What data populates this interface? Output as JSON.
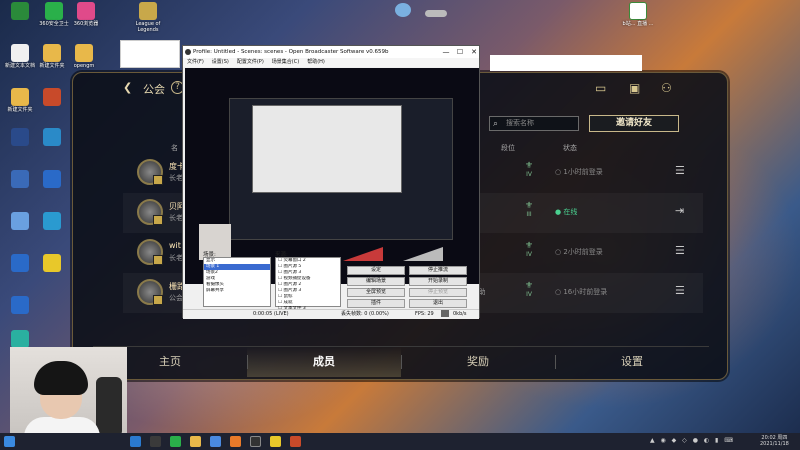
{
  "desktop": {
    "icons": [
      {
        "label": "",
        "color": "#2a8a3a"
      },
      {
        "label": "360安全卫士",
        "color": "#2ab04a"
      },
      {
        "label": "360浏览器",
        "color": "#e04a8a"
      },
      {
        "label": "League of Legends",
        "color": "#c8a84a"
      },
      {
        "label": "新建文本文档",
        "color": "#f0f0f0"
      },
      {
        "label": "新建文件夹",
        "color": "#e8b84a"
      },
      {
        "label": "opengm",
        "color": "#e8b84a"
      },
      {
        "label": "新建文件夹",
        "color": "#e8b84a"
      },
      {
        "label": "",
        "color": "#c84a2a"
      },
      {
        "label": "",
        "color": "#2a4a8a"
      },
      {
        "label": "",
        "color": "#2a8ac8"
      },
      {
        "label": "",
        "color": "#3a6ab8"
      },
      {
        "label": "",
        "color": "#2a6ac8"
      },
      {
        "label": "",
        "color": "#6aa0e0"
      },
      {
        "label": "",
        "color": "#2a9ad0"
      },
      {
        "label": "",
        "color": "#2a6ac8"
      },
      {
        "label": "",
        "color": "#e8c82a"
      },
      {
        "label": "",
        "color": "#2a6ac8"
      },
      {
        "label": "",
        "color": "#2ab0a0"
      }
    ],
    "right_icon_label": "b站...  直播 ..."
  },
  "client": {
    "title": "公会",
    "search_placeholder": "搜索名称",
    "invite_button": "邀请好友",
    "columns": {
      "name": "名",
      "tier": "段位",
      "status": "状态"
    },
    "members": [
      {
        "name": "度卡",
        "role": "长老",
        "tier": "IV",
        "status": "1小时前登录",
        "online": false,
        "action": "menu-icon"
      },
      {
        "name": "贝阿",
        "role": "长老",
        "tier": "III",
        "status": "在线",
        "online": true,
        "action": "exit-icon"
      },
      {
        "name": "wit",
        "role": "长老",
        "tier": "IV",
        "status": "2小时前登录",
        "online": false,
        "action": "menu-icon"
      },
      {
        "name": "栅路小笨猪",
        "role": "公会会长",
        "tier": "IV",
        "status": "16小时前登录",
        "online": false,
        "action": "menu-icon",
        "score": "0",
        "position": "辅助"
      }
    ],
    "nav": [
      "主页",
      "成员",
      "奖励",
      "设置"
    ],
    "active_nav": 1
  },
  "obs": {
    "title": "Profile: Untitled - Scenes: scenes - Open Broadcaster Software v0.659b",
    "menu": [
      "文件(F)",
      "设置(S)",
      "配置文件(P)",
      "场景集合(C)",
      "帮助(H)"
    ],
    "scenes_label": "场景:",
    "sources_label": "来源:",
    "scenes": [
      "显示",
      "场景 1",
      "场景2",
      "游戏",
      "看摄像头",
      "屏幕共享"
    ],
    "sources": [
      "荧幕窗口 2",
      "图片源 5",
      "图片源 3",
      "视频捕捉设备",
      "图片源 2",
      "图片源 3",
      "鼠标",
      "成就",
      "文本文件 3"
    ],
    "buttons": {
      "settings": "设定",
      "stop_stream": "停止推流",
      "edit_scene": "编辑场景",
      "start_record": "开始录制",
      "fullscreen": "全屏预览",
      "stop_preview": "停止预览",
      "plugins": "插件",
      "exit": "退出"
    },
    "status": {
      "time": "0:00:05 (LIVE)",
      "dropped": "丢失帧数: 0 (0.00%)",
      "fps": "FPS: 29",
      "bitrate": "0kb/s"
    }
  },
  "taskbar": {
    "clock": "20:02 周四",
    "date": "2021/11/18"
  },
  "colors": {
    "accent_gold": "#c8b88a",
    "online_green": "#4ad090"
  }
}
